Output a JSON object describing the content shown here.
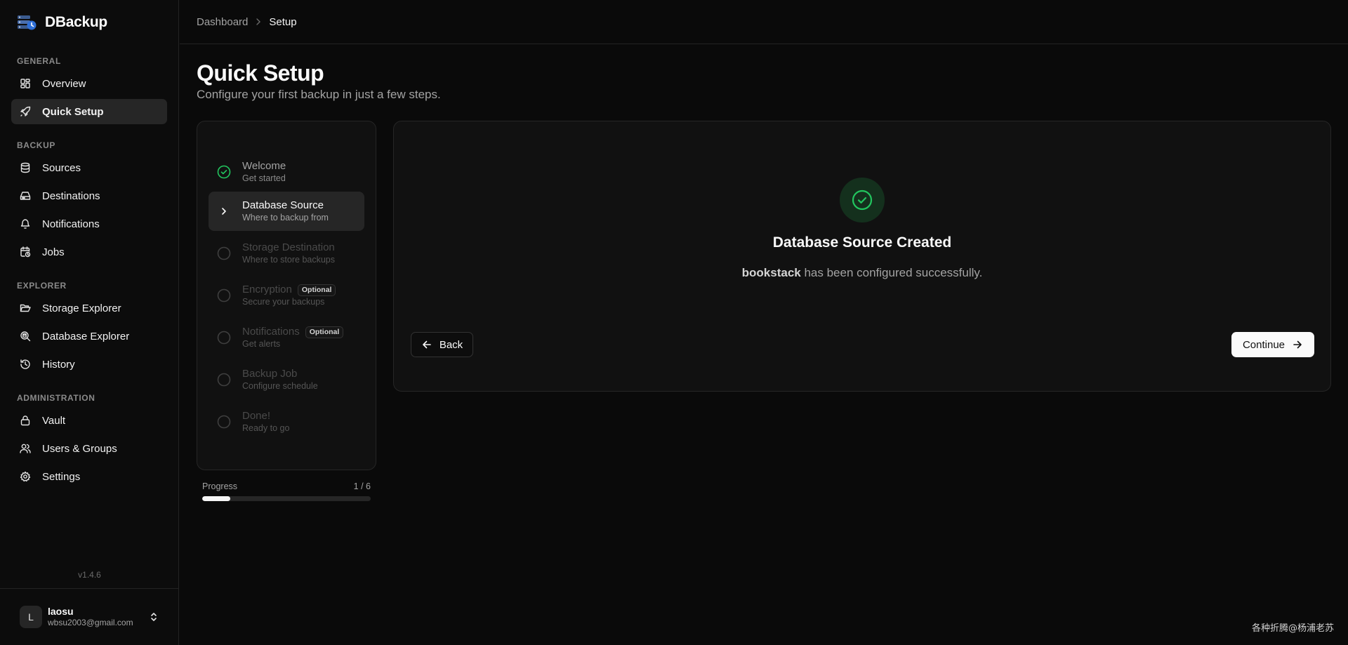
{
  "app": {
    "name": "DBackup",
    "version": "v1.4.6"
  },
  "sidebar": {
    "sections": [
      {
        "label": "GENERAL",
        "items": [
          {
            "label": "Overview",
            "icon": "layout-grid-icon"
          },
          {
            "label": "Quick Setup",
            "icon": "rocket-icon",
            "active": true
          }
        ]
      },
      {
        "label": "BACKUP",
        "items": [
          {
            "label": "Sources",
            "icon": "database-icon"
          },
          {
            "label": "Destinations",
            "icon": "hard-drive-icon"
          },
          {
            "label": "Notifications",
            "icon": "bell-icon"
          },
          {
            "label": "Jobs",
            "icon": "calendar-clock-icon"
          }
        ]
      },
      {
        "label": "EXPLORER",
        "items": [
          {
            "label": "Storage Explorer",
            "icon": "folder-open-icon"
          },
          {
            "label": "Database Explorer",
            "icon": "search-database-icon"
          },
          {
            "label": "History",
            "icon": "history-icon"
          }
        ]
      },
      {
        "label": "ADMINISTRATION",
        "items": [
          {
            "label": "Vault",
            "icon": "lock-icon"
          },
          {
            "label": "Users & Groups",
            "icon": "users-icon"
          },
          {
            "label": "Settings",
            "icon": "gear-icon"
          }
        ]
      }
    ],
    "user": {
      "initial": "L",
      "name": "laosu",
      "email": "wbsu2003@gmail.com"
    }
  },
  "breadcrumb": {
    "parent": "Dashboard",
    "current": "Setup"
  },
  "page": {
    "title": "Quick Setup",
    "subtitle": "Configure your first backup in just a few steps."
  },
  "steps": [
    {
      "title": "Welcome",
      "desc": "Get started",
      "state": "done"
    },
    {
      "title": "Database Source",
      "desc": "Where to backup from",
      "state": "current"
    },
    {
      "title": "Storage Destination",
      "desc": "Where to store backups",
      "state": "pending"
    },
    {
      "title": "Encryption",
      "desc": "Secure your backups",
      "state": "pending",
      "badge": "Optional"
    },
    {
      "title": "Notifications",
      "desc": "Get alerts",
      "state": "pending",
      "badge": "Optional"
    },
    {
      "title": "Backup Job",
      "desc": "Configure schedule",
      "state": "pending"
    },
    {
      "title": "Done!",
      "desc": "Ready to go",
      "state": "pending"
    }
  ],
  "progress": {
    "label": "Progress",
    "count": "1 / 6",
    "fraction": 0.1667
  },
  "panel": {
    "title": "Database Source Created",
    "source_name": "bookstack",
    "message_suffix": " has been configured successfully.",
    "back_label": "Back",
    "continue_label": "Continue"
  },
  "colors": {
    "accent_green": "#22c55e",
    "background": "#0a0a0a",
    "card": "#111111",
    "active_bg": "#262626"
  },
  "watermark": "各种折腾@杨浦老苏"
}
